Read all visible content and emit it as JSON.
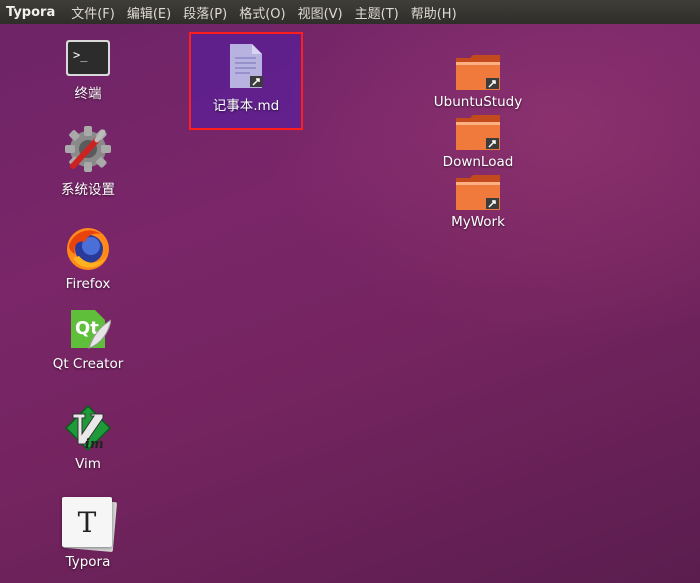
{
  "menubar": {
    "app_name": "Typora",
    "menus": [
      "文件(F)",
      "编辑(E)",
      "段落(P)",
      "格式(O)",
      "视图(V)",
      "主题(T)",
      "帮助(H)"
    ]
  },
  "launcher": [
    {
      "label": "终端",
      "icon": "terminal-icon"
    },
    {
      "label": "系统设置",
      "icon": "settings-icon"
    },
    {
      "label": "Firefox",
      "icon": "firefox-icon"
    },
    {
      "label": "Qt Creator",
      "icon": "qt-creator-icon"
    },
    {
      "label": "Vim",
      "icon": "vim-icon"
    },
    {
      "label": "Typora",
      "icon": "typora-icon",
      "glyph": "T"
    }
  ],
  "desktop_file": {
    "label": "记事本.md",
    "icon": "text-file-link-icon",
    "selected": true
  },
  "folders": [
    {
      "label": "UbuntuStudy",
      "icon": "folder-link-icon"
    },
    {
      "label": "DownLoad",
      "icon": "folder-link-icon"
    },
    {
      "label": "MyWork",
      "icon": "folder-link-icon"
    }
  ],
  "colors": {
    "highlight_border": "#ff1d1d",
    "folder": "#e9672f"
  },
  "terminal_prompt": ">_"
}
